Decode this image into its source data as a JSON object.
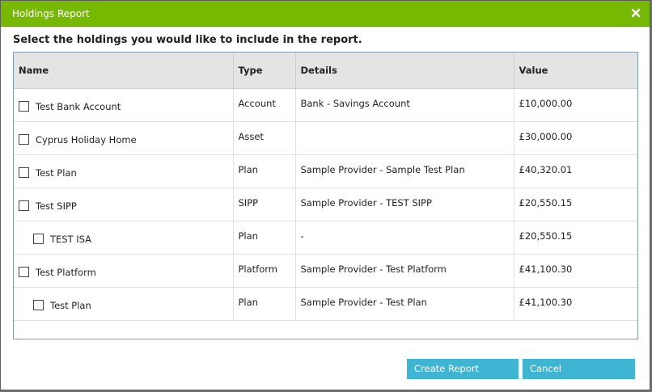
{
  "dialog": {
    "title": "Holdings Report",
    "prompt": "Select the holdings you would like to include in the report.",
    "columns": [
      "Name",
      "Type",
      "Details",
      "Value"
    ],
    "rows": [
      {
        "name": "Test Bank Account",
        "type": "Account",
        "details": "Bank - Savings Account",
        "value": "£10,000.00",
        "indented": false,
        "checked": false
      },
      {
        "name": "Cyprus Holiday Home",
        "type": "Asset",
        "details": "",
        "value": "£30,000.00",
        "indented": false,
        "checked": false
      },
      {
        "name": "Test Plan",
        "type": "Plan",
        "details": "Sample Provider - Sample Test Plan",
        "value": "£40,320.01",
        "indented": false,
        "checked": false
      },
      {
        "name": "Test SIPP",
        "type": "SIPP",
        "details": "Sample Provider - TEST SIPP",
        "value": "£20,550.15",
        "indented": false,
        "checked": false
      },
      {
        "name": "TEST ISA",
        "type": "Plan",
        "details": "-",
        "value": "£20,550.15",
        "indented": true,
        "checked": false
      },
      {
        "name": "Test Platform",
        "type": "Platform",
        "details": "Sample Provider - Test Platform",
        "value": "£41,100.30",
        "indented": false,
        "checked": false
      },
      {
        "name": "Test Plan",
        "type": "Plan",
        "details": "Sample Provider - Test Plan",
        "value": "£41,100.30",
        "indented": true,
        "checked": false
      }
    ],
    "buttons": {
      "create_label": "Create Report",
      "cancel_label": "Cancel"
    },
    "icons": {
      "close": "close-icon"
    },
    "colors": {
      "titlebar": "#76b900",
      "button": "#3fb5d4"
    }
  }
}
